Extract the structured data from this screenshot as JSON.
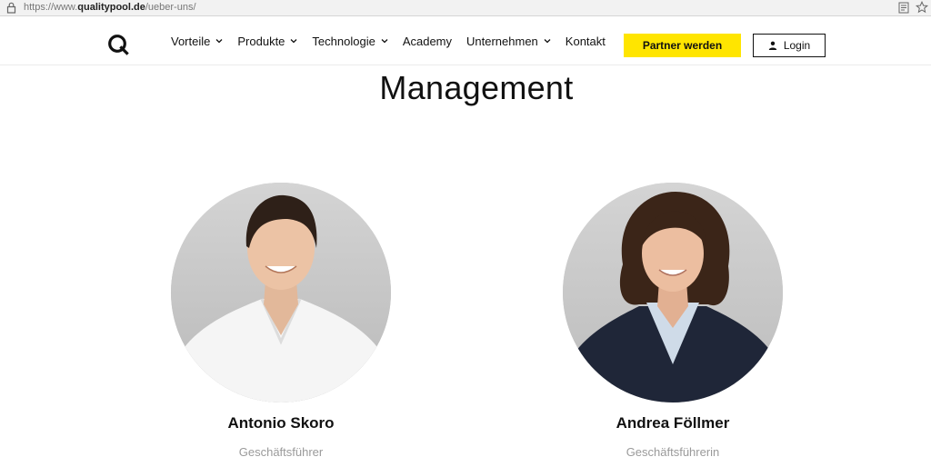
{
  "browser": {
    "url_prefix": "https://www.",
    "url_domain": "qualitypool.de",
    "url_path": "/ueber-uns/"
  },
  "nav": {
    "items": [
      {
        "label": "Vorteile",
        "dropdown": true
      },
      {
        "label": "Produkte",
        "dropdown": true
      },
      {
        "label": "Technologie",
        "dropdown": true
      },
      {
        "label": "Academy",
        "dropdown": false
      },
      {
        "label": "Unternehmen",
        "dropdown": true
      },
      {
        "label": "Kontakt",
        "dropdown": false
      }
    ],
    "partner_label": "Partner werden",
    "login_label": "Login"
  },
  "section": {
    "title": "Management"
  },
  "people": [
    {
      "name": "Antonio Skoro",
      "role": "Geschäftsführer"
    },
    {
      "name": "Andrea Föllmer",
      "role": "Geschäftsführerin"
    }
  ],
  "colors": {
    "accent": "#ffe500",
    "text": "#111111",
    "muted": "#9a9a9a"
  }
}
